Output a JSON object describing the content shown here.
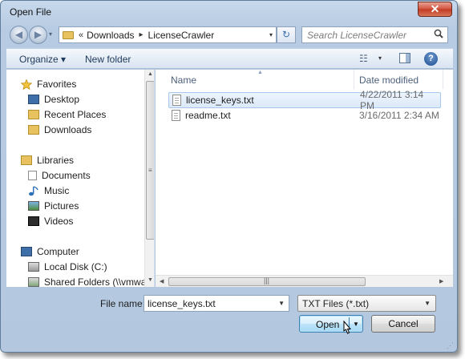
{
  "window": {
    "title": "Open File",
    "close_glyph": "✕"
  },
  "navigation": {
    "back_glyph": "◀",
    "forward_glyph": "▶",
    "recent_dropdown_glyph": "▾",
    "breadcrumb_prefix": "«",
    "breadcrumb": [
      "Downloads",
      "LicenseCrawler"
    ],
    "breadcrumb_sep": "▸",
    "address_dropdown_glyph": "▾",
    "refresh_glyph": "↻",
    "search_placeholder": "Search LicenseCrawler",
    "search_icon": "search-icon"
  },
  "toolbar": {
    "organize_label": "Organize ▾",
    "new_folder_label": "New folder",
    "views_glyph": "☷",
    "views_dropdown_glyph": "▾",
    "help_label": "?"
  },
  "sidebar": {
    "favorites": {
      "label": "Favorites",
      "items": [
        "Desktop",
        "Recent Places",
        "Downloads"
      ]
    },
    "libraries": {
      "label": "Libraries",
      "items": [
        "Documents",
        "Music",
        "Pictures",
        "Videos"
      ]
    },
    "computer": {
      "label": "Computer",
      "items": [
        "Local Disk (C:)",
        "Shared Folders (\\\\vmware-"
      ]
    }
  },
  "file_list": {
    "columns": [
      "Name",
      "Date modified"
    ],
    "files": [
      {
        "name": "license_keys.txt",
        "date": "4/22/2011 3:14 PM",
        "selected": true
      },
      {
        "name": "readme.txt",
        "date": "3/16/2011 2:34 AM",
        "selected": false
      }
    ]
  },
  "bottom": {
    "file_name_label": "File name:",
    "file_name_value": "license_keys.txt",
    "file_type_value": "TXT Files (*.txt)",
    "open_label": "Open",
    "cancel_label": "Cancel"
  },
  "colors": {
    "window_chrome": "#b9cde3",
    "selection_fill": "#dbe9f9",
    "selection_border": "#a7c7ea",
    "default_button": "#a7d9f5",
    "close_button": "#c13a22"
  }
}
